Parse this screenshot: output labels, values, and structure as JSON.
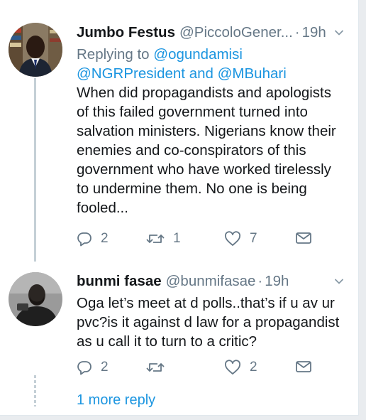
{
  "colors": {
    "link": "#1b95e0",
    "muted": "#657786",
    "text": "#14171a",
    "thread_line": "#c4cfd6"
  },
  "tweets": [
    {
      "name": "Jumbo Festus",
      "handle": "@PiccoloGener...",
      "separator": "·",
      "time": "19h",
      "reply_prefix": "Replying to",
      "reply_to_1": "@ogundamisi",
      "reply_to_2": "@NGRPresident",
      "reply_and": "and",
      "reply_to_3": "@MBuhari",
      "lines": [
        "When did propagandists and apologists",
        "of this failed government turned into",
        "salvation ministers. Nigerians know their",
        "enemies and co-conspirators of this",
        "government who have worked tirelessly",
        "to undermine them. No one is being",
        "fooled..."
      ],
      "replies": "2",
      "retweets": "1",
      "likes": "7",
      "icons": [
        "reply-icon",
        "retweet-icon",
        "like-icon",
        "message-icon",
        "chevron-down-icon"
      ]
    },
    {
      "name": "bunmi fasae",
      "handle": "@bunmifasae",
      "separator": "·",
      "time": "19h",
      "lines": [
        "Oga let’s meet at d polls..that’s if u av ur",
        "pvc?is it against d law for a propagandist",
        "as u call it to turn to a critic?"
      ],
      "replies": "2",
      "retweets": "",
      "likes": "2",
      "icons": [
        "reply-icon",
        "retweet-icon",
        "like-icon",
        "message-icon",
        "chevron-down-icon"
      ]
    }
  ],
  "more_replies": "1 more reply"
}
